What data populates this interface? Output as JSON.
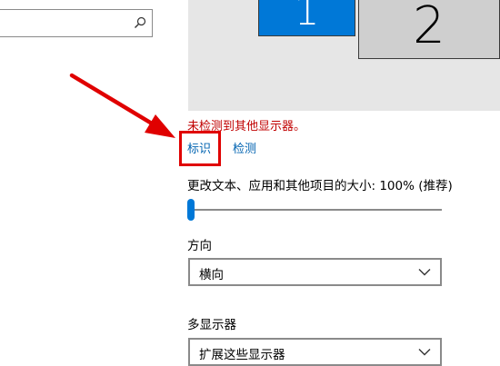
{
  "search": {
    "value": "",
    "placeholder": "",
    "icon": "search-icon"
  },
  "display_preview": {
    "monitors": [
      {
        "number": "1",
        "selected": true,
        "color": "#0078d7"
      },
      {
        "number": "2",
        "selected": false,
        "color": "#cfcfcf"
      }
    ]
  },
  "status": {
    "warning_text": "未检测到其他显示器。",
    "warning_color": "#c00000"
  },
  "actions": {
    "identify_label": "标识",
    "detect_label": "检测",
    "link_color": "#0063b1",
    "highlight_color": "#e00000"
  },
  "scale": {
    "label": "更改文本、应用和其他项目的大小: 100% (推荐)",
    "slider_value_fraction": 0.0,
    "accent_color": "#0078d7"
  },
  "orientation": {
    "label": "方向",
    "selected": "横向",
    "icon": "chevron-down-icon"
  },
  "multiple_displays": {
    "label": "多显示器",
    "selected": "扩展这些显示器",
    "icon": "chevron-down-icon"
  }
}
